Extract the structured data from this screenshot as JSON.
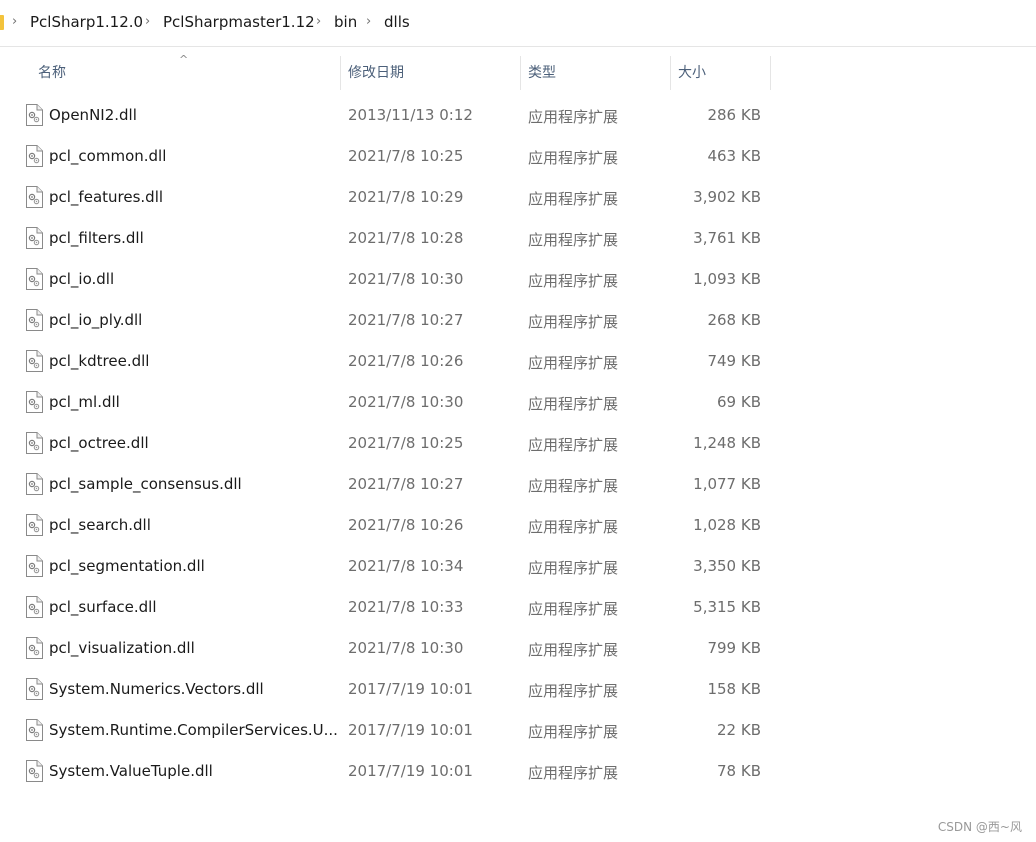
{
  "breadcrumb": [
    "PclSharp1.12.0",
    "PclSharpmaster1.12",
    "bin",
    "dlls"
  ],
  "columns": {
    "name": "名称",
    "date": "修改日期",
    "type": "类型",
    "size": "大小"
  },
  "files": [
    {
      "name": "OpenNI2.dll",
      "date": "2013/11/13 0:12",
      "type": "应用程序扩展",
      "size": "286 KB"
    },
    {
      "name": "pcl_common.dll",
      "date": "2021/7/8 10:25",
      "type": "应用程序扩展",
      "size": "463 KB"
    },
    {
      "name": "pcl_features.dll",
      "date": "2021/7/8 10:29",
      "type": "应用程序扩展",
      "size": "3,902 KB"
    },
    {
      "name": "pcl_filters.dll",
      "date": "2021/7/8 10:28",
      "type": "应用程序扩展",
      "size": "3,761 KB"
    },
    {
      "name": "pcl_io.dll",
      "date": "2021/7/8 10:30",
      "type": "应用程序扩展",
      "size": "1,093 KB"
    },
    {
      "name": "pcl_io_ply.dll",
      "date": "2021/7/8 10:27",
      "type": "应用程序扩展",
      "size": "268 KB"
    },
    {
      "name": "pcl_kdtree.dll",
      "date": "2021/7/8 10:26",
      "type": "应用程序扩展",
      "size": "749 KB"
    },
    {
      "name": "pcl_ml.dll",
      "date": "2021/7/8 10:30",
      "type": "应用程序扩展",
      "size": "69 KB"
    },
    {
      "name": "pcl_octree.dll",
      "date": "2021/7/8 10:25",
      "type": "应用程序扩展",
      "size": "1,248 KB"
    },
    {
      "name": "pcl_sample_consensus.dll",
      "date": "2021/7/8 10:27",
      "type": "应用程序扩展",
      "size": "1,077 KB"
    },
    {
      "name": "pcl_search.dll",
      "date": "2021/7/8 10:26",
      "type": "应用程序扩展",
      "size": "1,028 KB"
    },
    {
      "name": "pcl_segmentation.dll",
      "date": "2021/7/8 10:34",
      "type": "应用程序扩展",
      "size": "3,350 KB"
    },
    {
      "name": "pcl_surface.dll",
      "date": "2021/7/8 10:33",
      "type": "应用程序扩展",
      "size": "5,315 KB"
    },
    {
      "name": "pcl_visualization.dll",
      "date": "2021/7/8 10:30",
      "type": "应用程序扩展",
      "size": "799 KB"
    },
    {
      "name": "System.Numerics.Vectors.dll",
      "date": "2017/7/19 10:01",
      "type": "应用程序扩展",
      "size": "158 KB"
    },
    {
      "name": "System.Runtime.CompilerServices.U...",
      "date": "2017/7/19 10:01",
      "type": "应用程序扩展",
      "size": "22 KB"
    },
    {
      "name": "System.ValueTuple.dll",
      "date": "2017/7/19 10:01",
      "type": "应用程序扩展",
      "size": "78 KB"
    }
  ],
  "watermark": "CSDN @西~风",
  "icons": {
    "breadcrumb_separator": "chevron-right-icon",
    "sort": "sort-ascending-icon",
    "file": "dll-file-icon"
  },
  "colors": {
    "folder_accent": "#f3c33c",
    "header_text": "#4c607a",
    "secondary_text": "#6d6d6d"
  }
}
